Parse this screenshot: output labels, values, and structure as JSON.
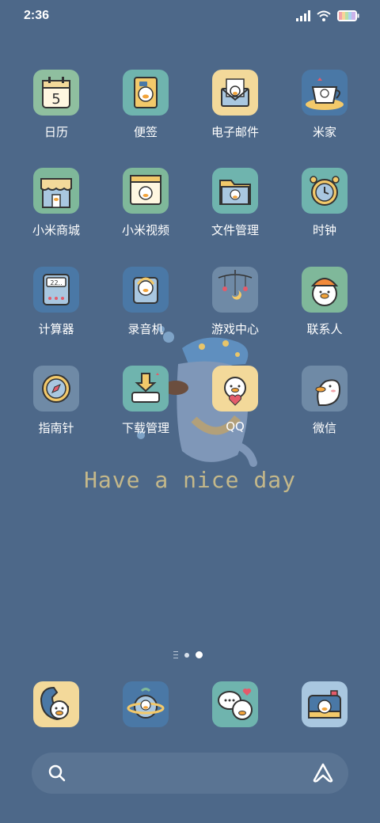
{
  "status_bar": {
    "time": "2:36",
    "icons": [
      "signal-icon",
      "wifi-icon",
      "battery-icon"
    ]
  },
  "home": {
    "rows": [
      [
        {
          "id": "calendar",
          "label": "日历",
          "bg": "#8fbf9f",
          "icon": "calendar-icon",
          "digit": "5"
        },
        {
          "id": "notes",
          "label": "便签",
          "bg": "#6fb4ae",
          "icon": "notes-icon"
        },
        {
          "id": "mail",
          "label": "电子邮件",
          "bg": "#f3d99a",
          "icon": "mail-icon"
        },
        {
          "id": "mijia",
          "label": "米家",
          "bg": "#4a78a6",
          "icon": "teacup-icon"
        }
      ],
      [
        {
          "id": "mistore",
          "label": "小米商城",
          "bg": "#7fb89a",
          "icon": "shop-icon"
        },
        {
          "id": "mivideo",
          "label": "小米视频",
          "bg": "#7fb89a",
          "icon": "video-icon"
        },
        {
          "id": "files",
          "label": "文件管理",
          "bg": "#6fb4ae",
          "icon": "folder-icon"
        },
        {
          "id": "clock",
          "label": "时钟",
          "bg": "#6fb4ae",
          "icon": "alarm-clock-icon"
        }
      ],
      [
        {
          "id": "calculator",
          "label": "计算器",
          "bg": "#4a78a6",
          "icon": "calculator-icon",
          "screen": "22.."
        },
        {
          "id": "recorder",
          "label": "录音机",
          "bg": "#4a78a6",
          "icon": "recorder-icon"
        },
        {
          "id": "games",
          "label": "游戏中心",
          "bg": "#6f8aa6",
          "icon": "mobile-icon"
        },
        {
          "id": "contacts",
          "label": "联系人",
          "bg": "#7fb89a",
          "icon": "duck-hat-icon"
        }
      ],
      [
        {
          "id": "compass",
          "label": "指南针",
          "bg": "#6f8aa6",
          "icon": "compass-icon"
        },
        {
          "id": "downloads",
          "label": "下载管理",
          "bg": "#6fb4ae",
          "icon": "download-icon"
        },
        {
          "id": "qq",
          "label": "QQ",
          "bg": "#f3d99a",
          "icon": "duck-heart-icon"
        },
        {
          "id": "wechat",
          "label": "微信",
          "bg": "#6f8aa6",
          "icon": "duck-bubble-icon"
        }
      ]
    ]
  },
  "wallpaper": {
    "text": "Have a nice day",
    "art": "sleepy-goose-icon"
  },
  "page_indicator": {
    "pages": 2,
    "current": 2
  },
  "dock": [
    {
      "id": "phone",
      "bg": "#f3d99a",
      "icon": "phone-icon"
    },
    {
      "id": "browser",
      "bg": "#4a78a6",
      "icon": "planet-icon"
    },
    {
      "id": "messages",
      "bg": "#6fb4ae",
      "icon": "chat-icon"
    },
    {
      "id": "camera",
      "bg": "#a9c7e0",
      "icon": "camera-icon"
    }
  ],
  "search_bar": {
    "left_icon": "search-icon",
    "right_icon": "assistant-icon"
  }
}
